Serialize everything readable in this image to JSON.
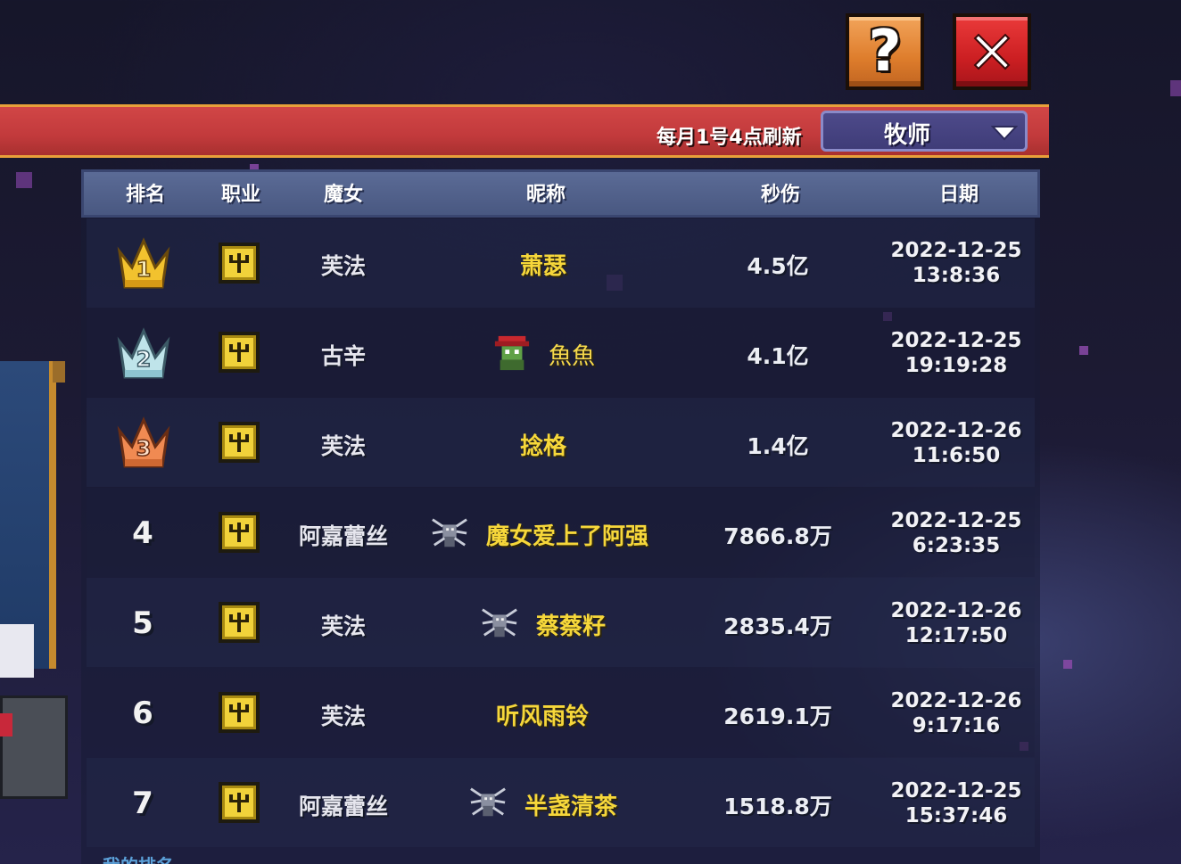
{
  "header": {
    "refresh_note": "每月1号4点刷新",
    "class_filter": "牧师"
  },
  "buttons": {
    "help_label": "?",
    "close_icon": "close-x-icon"
  },
  "table": {
    "columns": [
      "排名",
      "职业",
      "魔女",
      "昵称",
      "秒伤",
      "日期"
    ],
    "rows": [
      {
        "rank": "1",
        "rank_icon": "gold-crown-icon",
        "witch": "芙法",
        "nickname": "萧瑟",
        "avatar": "",
        "dps": "4.5亿",
        "date": "2022-12-25",
        "time": "13:8:36"
      },
      {
        "rank": "2",
        "rank_icon": "silver-crown-icon",
        "witch": "古辛",
        "nickname": "魚魚",
        "avatar": "red-goblin-avatar-icon",
        "dps": "4.1亿",
        "date": "2022-12-25",
        "time": "19:19:28"
      },
      {
        "rank": "3",
        "rank_icon": "bronze-crown-icon",
        "witch": "芙法",
        "nickname": "捻格",
        "avatar": "",
        "dps": "1.4亿",
        "date": "2022-12-26",
        "time": "11:6:50"
      },
      {
        "rank": "4",
        "rank_icon": "",
        "witch": "阿嘉蕾丝",
        "nickname": "魔女爱上了阿强",
        "avatar": "spider-avatar-icon",
        "dps": "7866.8万",
        "date": "2022-12-25",
        "time": "6:23:35"
      },
      {
        "rank": "5",
        "rank_icon": "",
        "witch": "芙法",
        "nickname": "蔡蔡籽",
        "avatar": "spider-avatar-icon",
        "dps": "2835.4万",
        "date": "2022-12-26",
        "time": "12:17:50"
      },
      {
        "rank": "6",
        "rank_icon": "",
        "witch": "芙法",
        "nickname": "听风雨铃",
        "avatar": "",
        "dps": "2619.1万",
        "date": "2022-12-26",
        "time": "9:17:16"
      },
      {
        "rank": "7",
        "rank_icon": "",
        "witch": "阿嘉蕾丝",
        "nickname": "半盏清茶",
        "avatar": "spider-avatar-icon",
        "dps": "1518.8万",
        "date": "2022-12-25",
        "time": "15:37:46"
      }
    ]
  },
  "footer": {
    "my_rank_label": "我的排名"
  },
  "colors": {
    "banner_red": "#c23a3c",
    "nickname_gold": "#f6d73a",
    "class_icon_yellow": "#f1d23a",
    "help_orange": "#de7d2c",
    "close_red": "#cc1f22"
  }
}
